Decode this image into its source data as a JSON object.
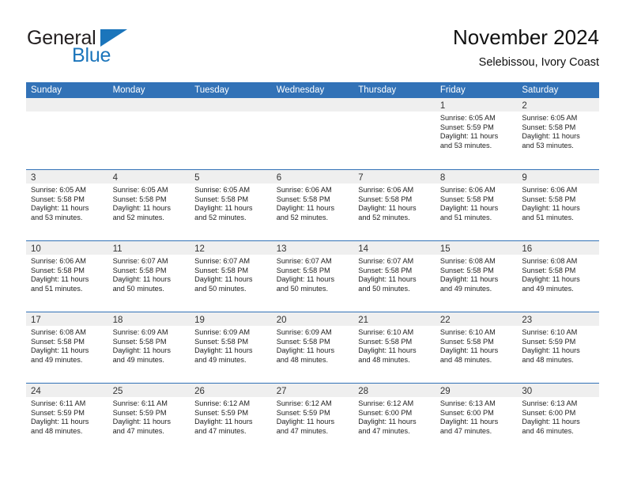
{
  "brand": {
    "name_top": "General",
    "name_bottom": "Blue",
    "color_dark": "#231f20",
    "color_blue": "#1b75bb"
  },
  "header": {
    "title": "November 2024",
    "subtitle": "Selebissou, Ivory Coast"
  },
  "theme": {
    "header_bg": "#3272b7",
    "day_band_bg": "#efefef",
    "row_divider": "#3272b7",
    "text": "#222222"
  },
  "calendar": {
    "weekdays": [
      "Sunday",
      "Monday",
      "Tuesday",
      "Wednesday",
      "Thursday",
      "Friday",
      "Saturday"
    ],
    "weeks": [
      [
        {
          "day": "",
          "sunrise": "",
          "sunset": "",
          "daylight_line1": "",
          "daylight_line2": ""
        },
        {
          "day": "",
          "sunrise": "",
          "sunset": "",
          "daylight_line1": "",
          "daylight_line2": ""
        },
        {
          "day": "",
          "sunrise": "",
          "sunset": "",
          "daylight_line1": "",
          "daylight_line2": ""
        },
        {
          "day": "",
          "sunrise": "",
          "sunset": "",
          "daylight_line1": "",
          "daylight_line2": ""
        },
        {
          "day": "",
          "sunrise": "",
          "sunset": "",
          "daylight_line1": "",
          "daylight_line2": ""
        },
        {
          "day": "1",
          "sunrise": "Sunrise: 6:05 AM",
          "sunset": "Sunset: 5:59 PM",
          "daylight_line1": "Daylight: 11 hours",
          "daylight_line2": "and 53 minutes."
        },
        {
          "day": "2",
          "sunrise": "Sunrise: 6:05 AM",
          "sunset": "Sunset: 5:58 PM",
          "daylight_line1": "Daylight: 11 hours",
          "daylight_line2": "and 53 minutes."
        }
      ],
      [
        {
          "day": "3",
          "sunrise": "Sunrise: 6:05 AM",
          "sunset": "Sunset: 5:58 PM",
          "daylight_line1": "Daylight: 11 hours",
          "daylight_line2": "and 53 minutes."
        },
        {
          "day": "4",
          "sunrise": "Sunrise: 6:05 AM",
          "sunset": "Sunset: 5:58 PM",
          "daylight_line1": "Daylight: 11 hours",
          "daylight_line2": "and 52 minutes."
        },
        {
          "day": "5",
          "sunrise": "Sunrise: 6:05 AM",
          "sunset": "Sunset: 5:58 PM",
          "daylight_line1": "Daylight: 11 hours",
          "daylight_line2": "and 52 minutes."
        },
        {
          "day": "6",
          "sunrise": "Sunrise: 6:06 AM",
          "sunset": "Sunset: 5:58 PM",
          "daylight_line1": "Daylight: 11 hours",
          "daylight_line2": "and 52 minutes."
        },
        {
          "day": "7",
          "sunrise": "Sunrise: 6:06 AM",
          "sunset": "Sunset: 5:58 PM",
          "daylight_line1": "Daylight: 11 hours",
          "daylight_line2": "and 52 minutes."
        },
        {
          "day": "8",
          "sunrise": "Sunrise: 6:06 AM",
          "sunset": "Sunset: 5:58 PM",
          "daylight_line1": "Daylight: 11 hours",
          "daylight_line2": "and 51 minutes."
        },
        {
          "day": "9",
          "sunrise": "Sunrise: 6:06 AM",
          "sunset": "Sunset: 5:58 PM",
          "daylight_line1": "Daylight: 11 hours",
          "daylight_line2": "and 51 minutes."
        }
      ],
      [
        {
          "day": "10",
          "sunrise": "Sunrise: 6:06 AM",
          "sunset": "Sunset: 5:58 PM",
          "daylight_line1": "Daylight: 11 hours",
          "daylight_line2": "and 51 minutes."
        },
        {
          "day": "11",
          "sunrise": "Sunrise: 6:07 AM",
          "sunset": "Sunset: 5:58 PM",
          "daylight_line1": "Daylight: 11 hours",
          "daylight_line2": "and 50 minutes."
        },
        {
          "day": "12",
          "sunrise": "Sunrise: 6:07 AM",
          "sunset": "Sunset: 5:58 PM",
          "daylight_line1": "Daylight: 11 hours",
          "daylight_line2": "and 50 minutes."
        },
        {
          "day": "13",
          "sunrise": "Sunrise: 6:07 AM",
          "sunset": "Sunset: 5:58 PM",
          "daylight_line1": "Daylight: 11 hours",
          "daylight_line2": "and 50 minutes."
        },
        {
          "day": "14",
          "sunrise": "Sunrise: 6:07 AM",
          "sunset": "Sunset: 5:58 PM",
          "daylight_line1": "Daylight: 11 hours",
          "daylight_line2": "and 50 minutes."
        },
        {
          "day": "15",
          "sunrise": "Sunrise: 6:08 AM",
          "sunset": "Sunset: 5:58 PM",
          "daylight_line1": "Daylight: 11 hours",
          "daylight_line2": "and 49 minutes."
        },
        {
          "day": "16",
          "sunrise": "Sunrise: 6:08 AM",
          "sunset": "Sunset: 5:58 PM",
          "daylight_line1": "Daylight: 11 hours",
          "daylight_line2": "and 49 minutes."
        }
      ],
      [
        {
          "day": "17",
          "sunrise": "Sunrise: 6:08 AM",
          "sunset": "Sunset: 5:58 PM",
          "daylight_line1": "Daylight: 11 hours",
          "daylight_line2": "and 49 minutes."
        },
        {
          "day": "18",
          "sunrise": "Sunrise: 6:09 AM",
          "sunset": "Sunset: 5:58 PM",
          "daylight_line1": "Daylight: 11 hours",
          "daylight_line2": "and 49 minutes."
        },
        {
          "day": "19",
          "sunrise": "Sunrise: 6:09 AM",
          "sunset": "Sunset: 5:58 PM",
          "daylight_line1": "Daylight: 11 hours",
          "daylight_line2": "and 49 minutes."
        },
        {
          "day": "20",
          "sunrise": "Sunrise: 6:09 AM",
          "sunset": "Sunset: 5:58 PM",
          "daylight_line1": "Daylight: 11 hours",
          "daylight_line2": "and 48 minutes."
        },
        {
          "day": "21",
          "sunrise": "Sunrise: 6:10 AM",
          "sunset": "Sunset: 5:58 PM",
          "daylight_line1": "Daylight: 11 hours",
          "daylight_line2": "and 48 minutes."
        },
        {
          "day": "22",
          "sunrise": "Sunrise: 6:10 AM",
          "sunset": "Sunset: 5:58 PM",
          "daylight_line1": "Daylight: 11 hours",
          "daylight_line2": "and 48 minutes."
        },
        {
          "day": "23",
          "sunrise": "Sunrise: 6:10 AM",
          "sunset": "Sunset: 5:59 PM",
          "daylight_line1": "Daylight: 11 hours",
          "daylight_line2": "and 48 minutes."
        }
      ],
      [
        {
          "day": "24",
          "sunrise": "Sunrise: 6:11 AM",
          "sunset": "Sunset: 5:59 PM",
          "daylight_line1": "Daylight: 11 hours",
          "daylight_line2": "and 48 minutes."
        },
        {
          "day": "25",
          "sunrise": "Sunrise: 6:11 AM",
          "sunset": "Sunset: 5:59 PM",
          "daylight_line1": "Daylight: 11 hours",
          "daylight_line2": "and 47 minutes."
        },
        {
          "day": "26",
          "sunrise": "Sunrise: 6:12 AM",
          "sunset": "Sunset: 5:59 PM",
          "daylight_line1": "Daylight: 11 hours",
          "daylight_line2": "and 47 minutes."
        },
        {
          "day": "27",
          "sunrise": "Sunrise: 6:12 AM",
          "sunset": "Sunset: 5:59 PM",
          "daylight_line1": "Daylight: 11 hours",
          "daylight_line2": "and 47 minutes."
        },
        {
          "day": "28",
          "sunrise": "Sunrise: 6:12 AM",
          "sunset": "Sunset: 6:00 PM",
          "daylight_line1": "Daylight: 11 hours",
          "daylight_line2": "and 47 minutes."
        },
        {
          "day": "29",
          "sunrise": "Sunrise: 6:13 AM",
          "sunset": "Sunset: 6:00 PM",
          "daylight_line1": "Daylight: 11 hours",
          "daylight_line2": "and 47 minutes."
        },
        {
          "day": "30",
          "sunrise": "Sunrise: 6:13 AM",
          "sunset": "Sunset: 6:00 PM",
          "daylight_line1": "Daylight: 11 hours",
          "daylight_line2": "and 46 minutes."
        }
      ]
    ]
  }
}
